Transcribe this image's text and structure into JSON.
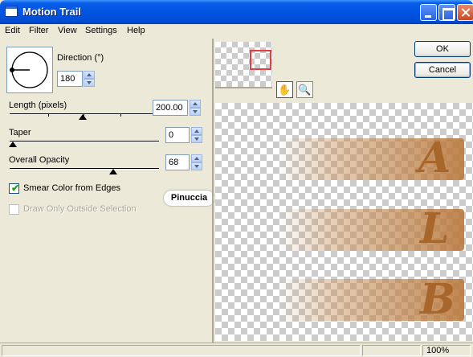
{
  "window": {
    "title": "Motion Trail",
    "minimize_icon": "minimize-icon",
    "maximize_icon": "maximize-icon",
    "close_icon": "close-icon"
  },
  "menu": [
    "Edit",
    "Filter",
    "View",
    "Settings",
    "Help"
  ],
  "controls": {
    "direction": {
      "label": "Direction (°)",
      "value": "180"
    },
    "length": {
      "label": "Length (pixels)",
      "value": "200.00"
    },
    "taper": {
      "label": "Taper",
      "value": "0"
    },
    "opacity": {
      "label": "Overall Opacity",
      "value": "68"
    },
    "smear": {
      "label": "Smear Color from Edges",
      "checked": true
    },
    "draw_only": {
      "label": "Draw Only Outside Selection",
      "checked": false,
      "enabled": false
    }
  },
  "badge": "Pinuccia",
  "buttons": {
    "ok": "OK",
    "cancel": "Cancel"
  },
  "tools": {
    "pan_icon": "hand-icon",
    "zoom_icon": "magnifier-icon"
  },
  "preview": {
    "letters": [
      "A",
      "L",
      "B"
    ]
  },
  "status": {
    "zoom": "100%"
  },
  "colors": {
    "titlebar": "#0054e3",
    "trail": "#c9915a",
    "glyph": "#a8662a"
  }
}
